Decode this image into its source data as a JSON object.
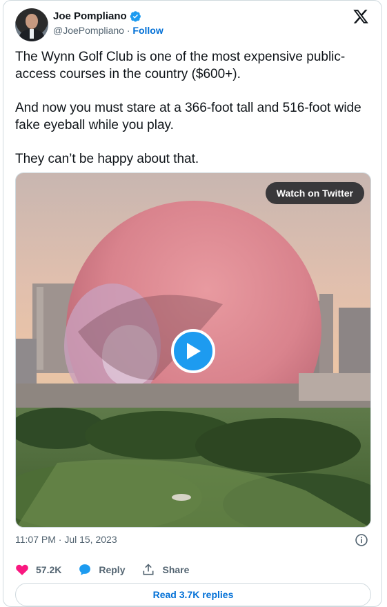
{
  "author": {
    "display_name": "Joe Pompliano",
    "handle": "@JoePompliano",
    "separator": "·",
    "follow_label": "Follow",
    "verified": true
  },
  "tweet": {
    "paragraphs": [
      "The Wynn Golf Club is one of the most expensive public-access courses in the country ($600+).",
      "And now you must stare at a 366-foot tall and 516-foot wide fake eyeball while you play.",
      "They can’t be happy about that."
    ],
    "timestamp": "11:07 PM · Jul 15, 2023"
  },
  "media": {
    "watch_label": "Watch on Twitter"
  },
  "actions": {
    "likes": "57.2K",
    "reply_label": "Reply",
    "share_label": "Share"
  },
  "footer": {
    "read_replies_label": "Read 3.7K replies"
  },
  "colors": {
    "accent": "#1d9bf0",
    "link": "#006fd6",
    "like": "#f91880",
    "muted": "#536471"
  }
}
